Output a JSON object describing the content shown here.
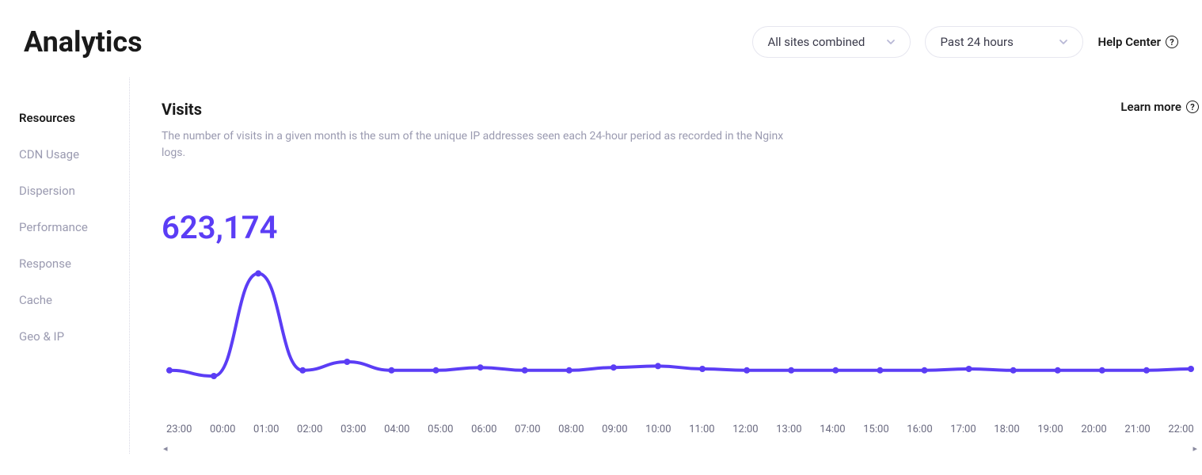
{
  "header": {
    "title": "Analytics",
    "site_dropdown": {
      "selected": "All sites combined"
    },
    "range_dropdown": {
      "selected": "Past 24 hours"
    },
    "help_label": "Help Center"
  },
  "sidebar": {
    "items": [
      {
        "label": "Resources",
        "active": true
      },
      {
        "label": "CDN Usage",
        "active": false
      },
      {
        "label": "Dispersion",
        "active": false
      },
      {
        "label": "Performance",
        "active": false
      },
      {
        "label": "Response",
        "active": false
      },
      {
        "label": "Cache",
        "active": false
      },
      {
        "label": "Geo & IP",
        "active": false
      }
    ]
  },
  "main": {
    "section_title": "Visits",
    "section_desc": "The number of visits in a given month is the sum of the unique IP addresses seen each 24-hour period as recorded in the Nginx logs.",
    "learn_label": "Learn more",
    "big_number": "623,174"
  },
  "chart_data": {
    "type": "line",
    "title": "Visits",
    "xlabel": "",
    "ylabel": "",
    "categories": [
      "23:00",
      "00:00",
      "01:00",
      "02:00",
      "03:00",
      "04:00",
      "05:00",
      "06:00",
      "07:00",
      "08:00",
      "09:00",
      "10:00",
      "11:00",
      "12:00",
      "13:00",
      "14:00",
      "15:00",
      "16:00",
      "17:00",
      "18:00",
      "19:00",
      "20:00",
      "21:00",
      "22:00"
    ],
    "values": [
      24000,
      20000,
      92000,
      24000,
      30000,
      24000,
      24000,
      26000,
      24000,
      24000,
      26000,
      27000,
      25000,
      24000,
      24000,
      24000,
      24000,
      24000,
      25000,
      24000,
      24000,
      24000,
      24000,
      25000
    ],
    "ylim": [
      0,
      100000
    ],
    "color": "#5b3df5"
  }
}
